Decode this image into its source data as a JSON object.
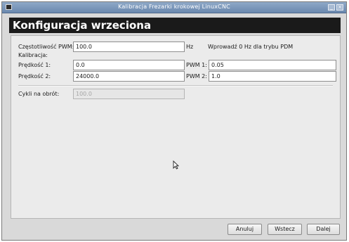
{
  "window": {
    "title": "Kalibracja Frezarki krokowej LinuxCNC",
    "minimize_glyph": "_",
    "close_glyph": "×"
  },
  "header": {
    "title": "Konfiguracja wrzeciona"
  },
  "form": {
    "pwm_freq_label": "Częstotliwość PWM:",
    "pwm_freq_value": "100.0",
    "pwm_freq_unit": "Hz",
    "pwm_freq_hint": "Wprowadź 0 Hz dla trybu PDM",
    "calibration_label": "Kalibracja:",
    "speed1_label": "Prędkość 1:",
    "speed1_value": "0.0",
    "pwm1_label": "PWM 1:",
    "pwm1_value": "0.05",
    "speed2_label": "Prędkość 2:",
    "speed2_value": "24000.0",
    "pwm2_label": "PWM 2:",
    "pwm2_value": "1.0",
    "cycles_label": "Cykli na obrót:",
    "cycles_value": "100.0"
  },
  "buttons": {
    "cancel": "Anuluj",
    "back": "Wstecz",
    "next": "Dalej"
  },
  "colors": {
    "titlebar": "#6a88ae",
    "header_bg": "#1a1a1a",
    "window_bg": "#d9d9d9"
  },
  "icons": [
    "window-menu-icon",
    "minimize-icon",
    "close-icon",
    "mouse-cursor-icon"
  ]
}
